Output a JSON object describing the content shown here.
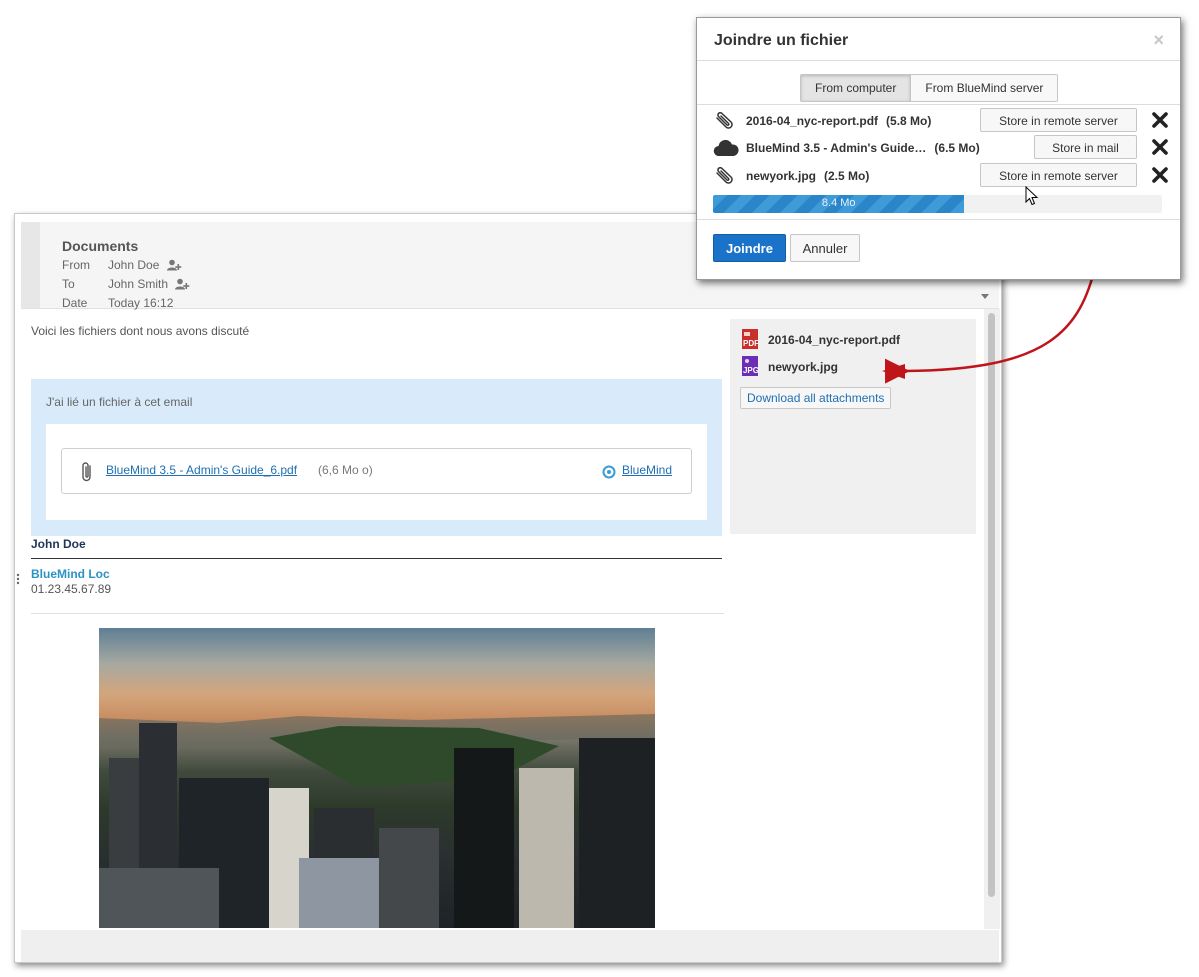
{
  "mail": {
    "subject": "Documents",
    "from_label": "From",
    "from_value": "John Doe",
    "to_label": "To",
    "to_value": "John Smith",
    "date_label": "Date",
    "date_value": "Today 16:12",
    "body_text": "Voici les fichiers dont nous avons discuté",
    "linked_title": "J'ai lié un fichier à cet email",
    "linked_file_name": "BlueMind 3.5 - Admin's Guide_6.pdf",
    "linked_file_size": "(6,6 Mo o)",
    "linked_source": "BlueMind",
    "signature_name": "John Doe",
    "signature_company": "BlueMind Loc",
    "signature_phone": "01.23.45.67.89"
  },
  "attachments": {
    "items": [
      {
        "name": "2016-04_nyc-report.pdf",
        "icon": "pdf-file-icon",
        "badge": "PDF"
      },
      {
        "name": "newyork.jpg",
        "icon": "jpg-file-icon",
        "badge": "JPG"
      }
    ],
    "download_all_label": "Download all attachments"
  },
  "dialog": {
    "title": "Joindre un fichier",
    "close_glyph": "×",
    "tabs": [
      {
        "label": "From computer",
        "active": true
      },
      {
        "label": "From BlueMind server",
        "active": false
      }
    ],
    "files": [
      {
        "name": "2016-04_nyc-report.pdf",
        "size": "(5.8 Mo)",
        "icon": "paperclip-icon",
        "action": "Store in remote server"
      },
      {
        "name": "BlueMind 3.5 - Admin's Guide…",
        "size": "(6.5 Mo)",
        "icon": "cloud-icon",
        "action": "Store in mail"
      },
      {
        "name": "newyork.jpg",
        "size": "(2.5 Mo)",
        "icon": "paperclip-icon",
        "action": "Store in remote server"
      }
    ],
    "progress_text": "8.4 Mo",
    "progress_fraction": 0.56,
    "confirm_label": "Joindre",
    "cancel_label": "Annuler"
  },
  "colors": {
    "primary_button": "#1a73c8",
    "link": "#1f6fb2",
    "linked_box_bg": "#d9eafa",
    "signature_company": "#2b93c4",
    "annotation_arrow": "#c0141b",
    "progress_fill": "#3f9ad8"
  }
}
